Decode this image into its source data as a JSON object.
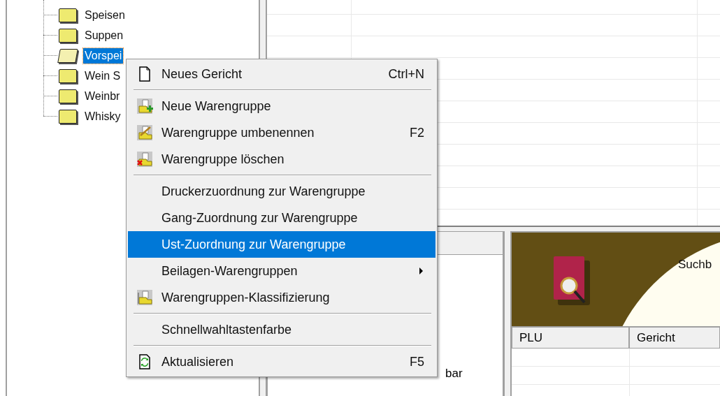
{
  "tree": {
    "items": [
      {
        "label": "Speisen",
        "selected": false
      },
      {
        "label": "Suppen",
        "selected": false
      },
      {
        "label": "Vorspei",
        "selected": true
      },
      {
        "label": "Wein S",
        "selected": false
      },
      {
        "label": "Weinbr",
        "selected": false
      },
      {
        "label": "Whisky",
        "selected": false
      }
    ]
  },
  "context_menu": {
    "items": [
      {
        "kind": "item",
        "label": "Neues Gericht",
        "shortcut": "Ctrl+N",
        "selected": false
      },
      {
        "kind": "separator"
      },
      {
        "kind": "item",
        "label": "Neue Warengruppe",
        "selected": false
      },
      {
        "kind": "item",
        "label": "Warengruppe umbenennen",
        "shortcut": "F2",
        "selected": false
      },
      {
        "kind": "item",
        "label": "Warengruppe löschen",
        "selected": false
      },
      {
        "kind": "separator"
      },
      {
        "kind": "item",
        "label": "Druckerzuordnung zur Warengruppe",
        "selected": false
      },
      {
        "kind": "item",
        "label": "Gang-Zuordnung zur Warengruppe",
        "selected": false
      },
      {
        "kind": "item",
        "label": "Ust-Zuordnung zur Warengruppe",
        "selected": true
      },
      {
        "kind": "item",
        "label": "Beilagen-Warengruppen",
        "submenu": true,
        "selected": false
      },
      {
        "kind": "item",
        "label": "Warengruppen-Klassifizierung",
        "selected": false
      },
      {
        "kind": "separator"
      },
      {
        "kind": "item",
        "label": "Schnellwahltastenfarbe",
        "selected": false
      },
      {
        "kind": "separator"
      },
      {
        "kind": "item",
        "label": "Aktualisieren",
        "shortcut": "F5",
        "selected": false
      }
    ]
  },
  "middle_panel": {
    "text": "bar"
  },
  "search_panel": {
    "banner_text": "Suchb",
    "columns": [
      "PLU",
      "Gericht"
    ]
  }
}
